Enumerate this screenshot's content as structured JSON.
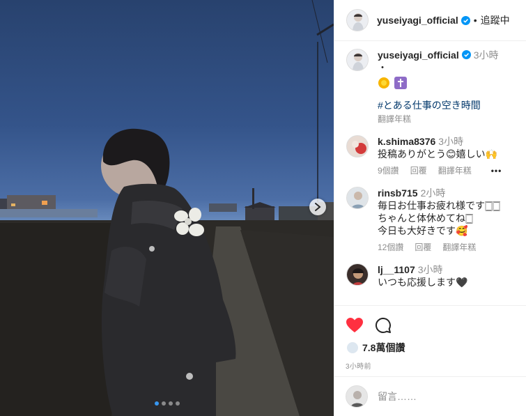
{
  "post": {
    "author": "yuseiyagi_official",
    "follow_label": "追蹤中",
    "separator": "•",
    "caption_time": "3小時",
    "caption_dot": "・",
    "caption_emoji_icons": [
      "sun-emoji-icon",
      "cross-emoji-icon"
    ],
    "hashtag": "#とある仕事の空き時間",
    "translate_label": "翻譯年糕"
  },
  "media": {
    "current_index": 0,
    "total_slides": 4
  },
  "comments": [
    {
      "username": "k.shima8376",
      "time": "3小時",
      "text": "投稿ありがとう😊嬉しい🙌",
      "likes": "9個讚",
      "reply_label": "回覆",
      "translate_label": "翻譯年糕",
      "more": "•••"
    },
    {
      "username": "rinsb715",
      "time": "2小時",
      "text_lines": [
        "毎日お仕事お疲れ様です🀆🀆",
        "ちゃんと体休めてね🀆",
        "今日も大好きです🥰"
      ],
      "likes": "12個讚",
      "reply_label": "回覆",
      "translate_label": "翻譯年糕"
    },
    {
      "username": "lj__1107",
      "time": "3小時",
      "text": "いつも応援します🖤"
    }
  ],
  "actions": {
    "likes_count": "7.8萬個讚",
    "posted_ago": "3小時前"
  },
  "comment_input": {
    "placeholder": "留言……"
  },
  "colors": {
    "like_red": "#ff3040",
    "verified_blue": "#0095f6",
    "hashtag_blue": "#00376b",
    "secondary_text": "#8e8e8e"
  }
}
